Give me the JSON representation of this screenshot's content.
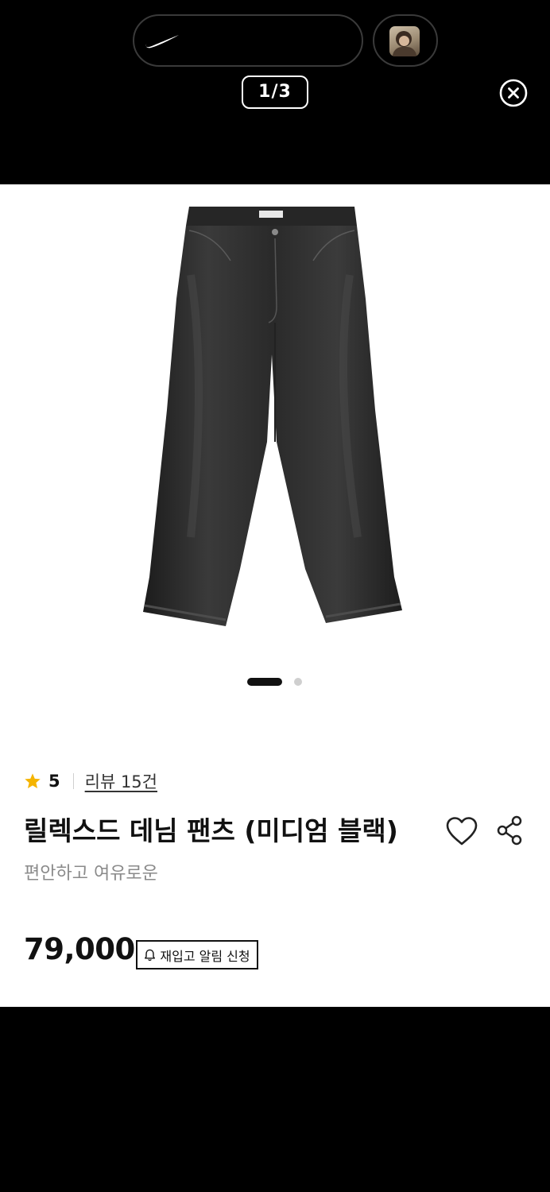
{
  "viewer": {
    "brand_icon": "nike-swoosh-icon",
    "avatar_icon": "profile-avatar",
    "page_counter": "1/3",
    "close_icon": "close-circle-icon"
  },
  "carousel": {
    "image_icon": "black-denim-pants-image",
    "total_dots": 2,
    "active_index": 0
  },
  "product": {
    "rating": "5",
    "review_link": "리뷰 15건",
    "title": "릴렉스드 데님 팬츠 (미디엄 블랙)",
    "subtitle": "편안하고 여유로운",
    "price": "79,000",
    "restock_label": "재입고 알림 신청",
    "icons": {
      "star": "star-icon",
      "heart": "heart-icon",
      "share": "share-icon",
      "bell": "bell-icon"
    },
    "colors": {
      "star": "#F5B400",
      "text": "#111111",
      "muted": "#8A8A8A"
    }
  }
}
